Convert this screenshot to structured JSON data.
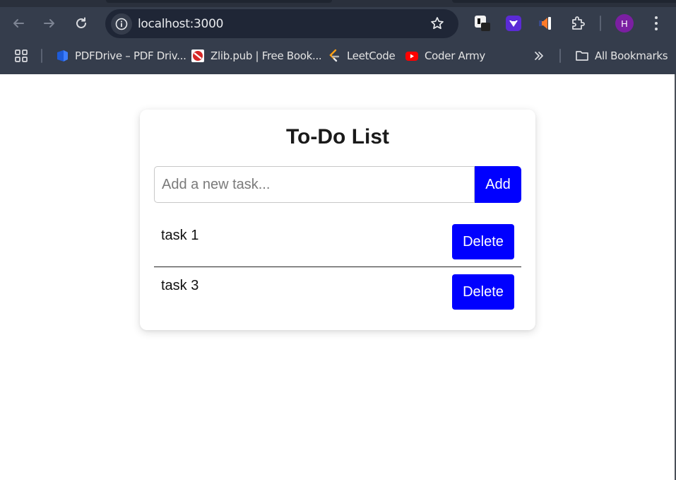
{
  "browser": {
    "url": "localhost:3000",
    "bookmarks": [
      {
        "label": "PDFDrive – PDF Driv...",
        "icon": "pdfdrive-icon"
      },
      {
        "label": "Zlib.pub | Free Book...",
        "icon": "zlib-icon"
      },
      {
        "label": "LeetCode",
        "icon": "leetcode-icon"
      },
      {
        "label": "Coder Army",
        "icon": "youtube-icon"
      }
    ],
    "all_bookmarks_label": "All Bookmarks",
    "profile_initial": "H",
    "colors": {
      "toolbar": "#353d4c",
      "omnibox": "#1f2636",
      "avatar": "#7b1fa2"
    }
  },
  "app": {
    "title": "To-Do List",
    "input_placeholder": "Add a new task...",
    "input_value": "",
    "add_label": "Add",
    "tasks": [
      {
        "text": "task 1",
        "delete_label": "Delete"
      },
      {
        "text": "task 3",
        "delete_label": "Delete"
      }
    ],
    "colors": {
      "button": "#0000ff",
      "button_text": "#ffffff"
    }
  }
}
